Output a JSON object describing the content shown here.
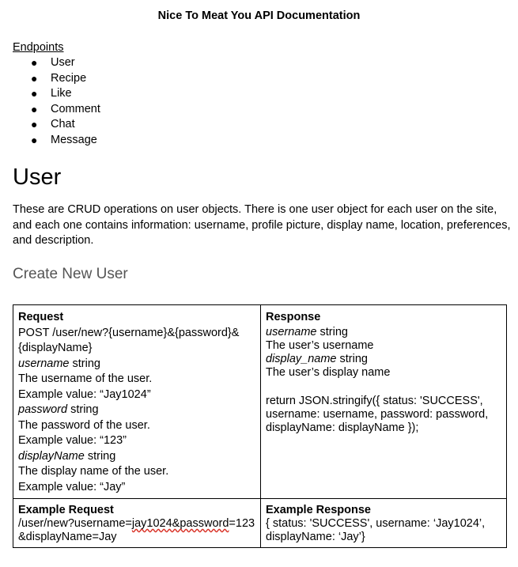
{
  "doc": {
    "title": "Nice To Meat You API Documentation"
  },
  "endpoints": {
    "heading": "Endpoints",
    "bullet": "●",
    "items": [
      "User",
      "Recipe",
      "Like",
      "Comment",
      "Chat",
      "Message"
    ]
  },
  "user_section": {
    "title": "User",
    "description": "These are CRUD operations on user objects. There is one user object for each user on the site, and each one contains information: username, profile picture, display name, location, preferences, and description.",
    "create": {
      "title": "Create New User",
      "request": {
        "heading": "Request",
        "endpoint": "POST /user/new?{username}&{password}&{displayName}",
        "params": [
          {
            "name": "username",
            "type": " string",
            "desc": "The username of the user.",
            "example": "Example value: “Jay1024”"
          },
          {
            "name": "password",
            "type": " string",
            "desc": "The password of the user.",
            "example": "Example value: “123”"
          },
          {
            "name": "displayName",
            "type": " string",
            "desc": "The display name of the user.",
            "example": "Example value: “Jay”"
          }
        ]
      },
      "response": {
        "heading": "Response",
        "fields": [
          {
            "name": "username",
            "type": " string",
            "desc": "The user’s username"
          },
          {
            "name": "display_name",
            "type": " string",
            "desc": "The user’s display name"
          }
        ],
        "code": "return JSON.stringify({ status: 'SUCCESS', username: username, password: password, displayName: displayName });"
      },
      "example_request": {
        "heading": "Example Request",
        "prefix": "/user/new?username=",
        "underlined": "jay1024&password",
        "suffix": "=123&displayName=Jay"
      },
      "example_response": {
        "heading": "Example Response",
        "value": "{ status: 'SUCCESS', username: ‘Jay1024’, displayName: ‘Jay’}"
      }
    }
  }
}
